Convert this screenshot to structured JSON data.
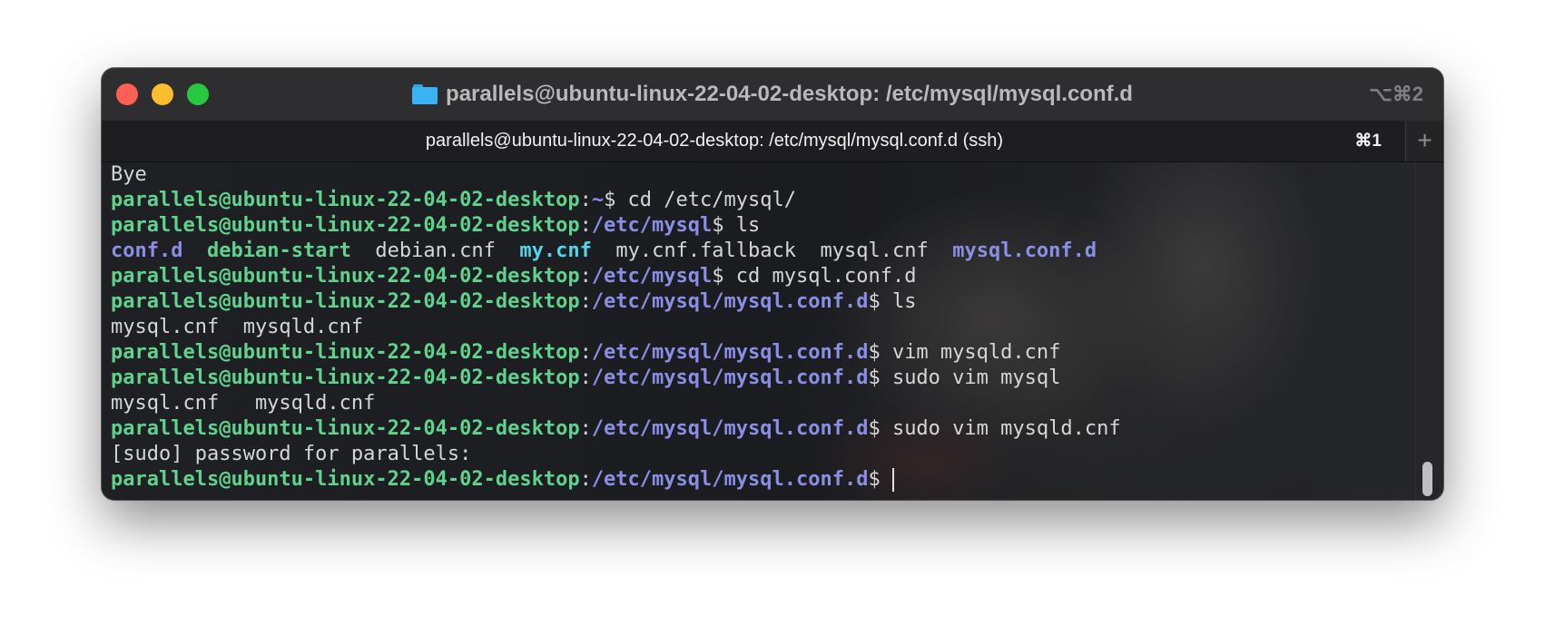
{
  "window": {
    "title": "parallels@ubuntu-linux-22-04-02-desktop: /etc/mysql/mysql.conf.d",
    "shortcut": "⌥⌘2",
    "folder_icon": "folder-icon"
  },
  "tab": {
    "title": "parallels@ubuntu-linux-22-04-02-desktop: /etc/mysql/mysql.conf.d (ssh)",
    "shortcut": "⌘1",
    "new_tab_label": "+"
  },
  "colors": {
    "host": "#5fd38d",
    "path": "#8a8ee6",
    "symlink": "#51d5e8",
    "text": "#d6d6d6"
  },
  "terminal": {
    "lines": [
      {
        "segments": [
          {
            "t": "Bye",
            "c": "plain"
          }
        ]
      },
      {
        "segments": [
          {
            "t": "parallels@ubuntu-linux-22-04-02-desktop",
            "c": "host"
          },
          {
            "t": ":",
            "c": "colon"
          },
          {
            "t": "~",
            "c": "path"
          },
          {
            "t": "$ cd /etc/mysql/",
            "c": "plain"
          }
        ]
      },
      {
        "segments": [
          {
            "t": "parallels@ubuntu-linux-22-04-02-desktop",
            "c": "host"
          },
          {
            "t": ":",
            "c": "colon"
          },
          {
            "t": "/etc/mysql",
            "c": "path"
          },
          {
            "t": "$ ls",
            "c": "plain"
          }
        ]
      },
      {
        "segments": [
          {
            "t": "conf.d",
            "c": "dir"
          },
          {
            "t": "  ",
            "c": "plain"
          },
          {
            "t": "debian-start",
            "c": "exec"
          },
          {
            "t": "  debian.cnf  ",
            "c": "plain"
          },
          {
            "t": "my.cnf",
            "c": "link"
          },
          {
            "t": "  my.cnf.fallback  mysql.cnf  ",
            "c": "plain"
          },
          {
            "t": "mysql.conf.d",
            "c": "dir"
          }
        ]
      },
      {
        "segments": [
          {
            "t": "parallels@ubuntu-linux-22-04-02-desktop",
            "c": "host"
          },
          {
            "t": ":",
            "c": "colon"
          },
          {
            "t": "/etc/mysql",
            "c": "path"
          },
          {
            "t": "$ cd mysql.conf.d",
            "c": "plain"
          }
        ]
      },
      {
        "segments": [
          {
            "t": "parallels@ubuntu-linux-22-04-02-desktop",
            "c": "host"
          },
          {
            "t": ":",
            "c": "colon"
          },
          {
            "t": "/etc/mysql/mysql.conf.d",
            "c": "path"
          },
          {
            "t": "$ ls",
            "c": "plain"
          }
        ]
      },
      {
        "segments": [
          {
            "t": "mysql.cnf  mysqld.cnf",
            "c": "plain"
          }
        ]
      },
      {
        "segments": [
          {
            "t": "parallels@ubuntu-linux-22-04-02-desktop",
            "c": "host"
          },
          {
            "t": ":",
            "c": "colon"
          },
          {
            "t": "/etc/mysql/mysql.conf.d",
            "c": "path"
          },
          {
            "t": "$ vim mysqld.cnf",
            "c": "plain"
          }
        ]
      },
      {
        "segments": [
          {
            "t": "parallels@ubuntu-linux-22-04-02-desktop",
            "c": "host"
          },
          {
            "t": ":",
            "c": "colon"
          },
          {
            "t": "/etc/mysql/mysql.conf.d",
            "c": "path"
          },
          {
            "t": "$ sudo vim mysql",
            "c": "plain"
          }
        ]
      },
      {
        "segments": [
          {
            "t": "mysql.cnf   mysqld.cnf",
            "c": "plain"
          }
        ]
      },
      {
        "segments": [
          {
            "t": "parallels@ubuntu-linux-22-04-02-desktop",
            "c": "host"
          },
          {
            "t": ":",
            "c": "colon"
          },
          {
            "t": "/etc/mysql/mysql.conf.d",
            "c": "path"
          },
          {
            "t": "$ sudo vim mysqld.cnf",
            "c": "plain"
          }
        ]
      },
      {
        "segments": [
          {
            "t": "[sudo] password for parallels:",
            "c": "plain"
          }
        ]
      },
      {
        "segments": [
          {
            "t": "parallels@ubuntu-linux-22-04-02-desktop",
            "c": "host"
          },
          {
            "t": ":",
            "c": "colon"
          },
          {
            "t": "/etc/mysql/mysql.conf.d",
            "c": "path"
          },
          {
            "t": "$ ",
            "c": "plain"
          }
        ],
        "cursor": true
      }
    ]
  }
}
